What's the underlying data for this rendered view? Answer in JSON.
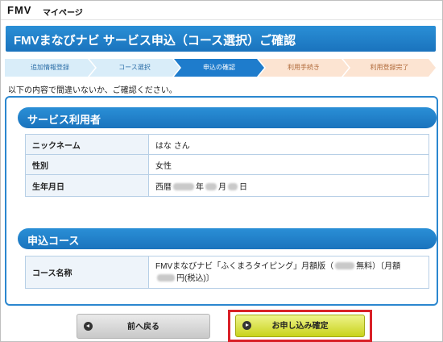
{
  "header": {
    "logo": "FMV",
    "logo_sub": "マイページ"
  },
  "page_title": "FMVまなびナビ サービス申込（コース選択）ご確認",
  "steps": [
    {
      "label": "追加情報登録",
      "state": "done"
    },
    {
      "label": "コース選択",
      "state": "done"
    },
    {
      "label": "申込の確認",
      "state": "current"
    },
    {
      "label": "利用手続き",
      "state": "future"
    },
    {
      "label": "利用登録完了",
      "state": "future"
    }
  ],
  "instruction": "以下の内容で間違いないか、ご確認ください。",
  "user_section": {
    "title": "サービス利用者",
    "rows": [
      {
        "key": "ニックネーム",
        "value": "はな さん"
      },
      {
        "key": "性別",
        "value": "女性"
      },
      {
        "key": "生年月日",
        "prefix": "西暦",
        "year_unit": "年",
        "month_unit": "月",
        "day_unit": "日"
      }
    ]
  },
  "course_section": {
    "title": "申込コース",
    "key": "コース名称",
    "value_part1": "FMVまなびナビ「ふくまろタイピング」月額版（",
    "value_part2": "無料）〔月額",
    "value_part3": "円(税込)〕"
  },
  "buttons": {
    "back": "前へ戻る",
    "confirm": "お申し込み確定"
  },
  "colors": {
    "accent_blue": "#1a73bd",
    "confirm_yellow": "#c9d31c",
    "highlight_red": "#d92027"
  }
}
